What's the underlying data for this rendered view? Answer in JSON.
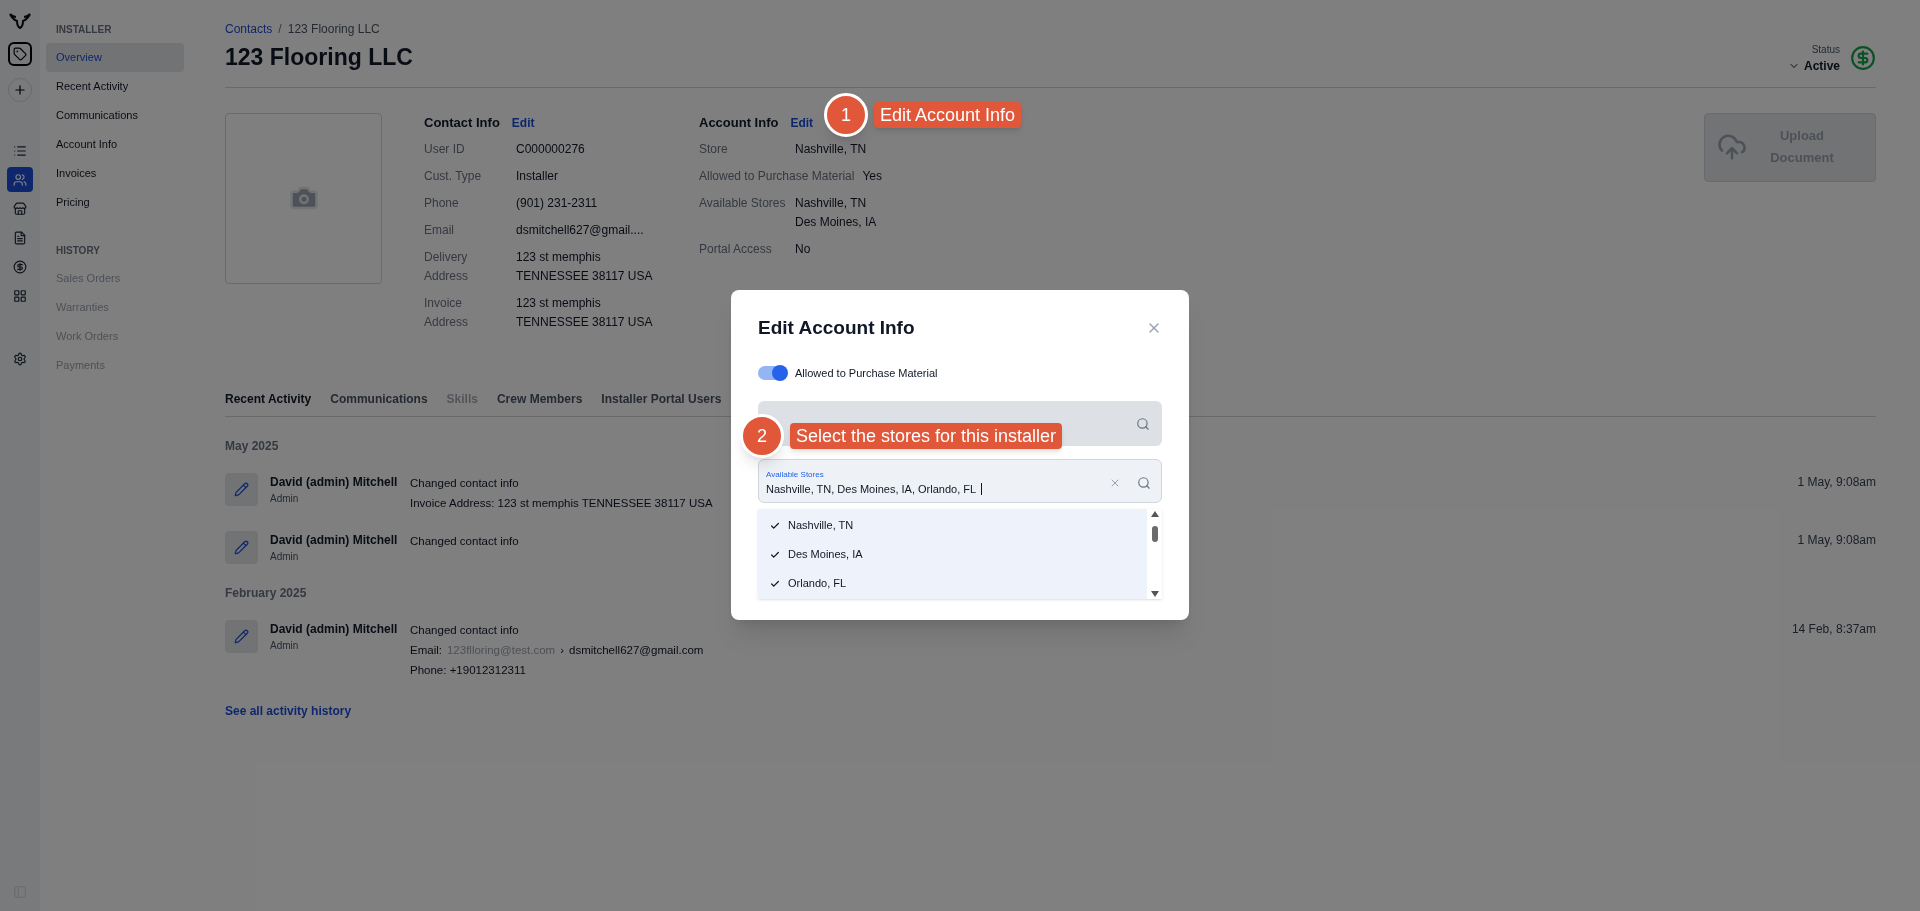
{
  "rail": [
    {
      "selected": false
    },
    {
      "selected": true
    },
    {
      "selected": false
    },
    {
      "selected": false
    },
    {
      "selected": false
    },
    {
      "selected": false
    },
    {
      "selected": false
    }
  ],
  "sidebar": [
    {
      "heading": "INSTALLER",
      "items": [
        {
          "label": "Overview",
          "selected": true,
          "disabled": false
        },
        {
          "label": "Recent Activity",
          "selected": false,
          "disabled": false
        },
        {
          "label": "Communications",
          "selected": false,
          "disabled": false
        },
        {
          "label": "Account Info",
          "selected": false,
          "disabled": false
        },
        {
          "label": "Invoices",
          "selected": false,
          "disabled": false
        },
        {
          "label": "Pricing",
          "selected": false,
          "disabled": false
        }
      ]
    },
    {
      "heading": "HISTORY",
      "items": [
        {
          "label": "Sales Orders",
          "selected": false,
          "disabled": true
        },
        {
          "label": "Warranties",
          "selected": false,
          "disabled": true
        },
        {
          "label": "Work Orders",
          "selected": false,
          "disabled": true
        },
        {
          "label": "Payments",
          "selected": false,
          "disabled": true
        }
      ]
    }
  ],
  "breadcrumb": {
    "link": "Contacts",
    "separator": "/",
    "current": "123 Flooring LLC"
  },
  "title": "123 Flooring LLC",
  "status": {
    "label": "Status",
    "value": "Active"
  },
  "contact_info": {
    "title": "Contact Info",
    "edit": "Edit",
    "rows": [
      {
        "label": "User ID",
        "values": [
          "C000000276"
        ]
      },
      {
        "label": "Cust. Type",
        "values": [
          "Installer"
        ]
      },
      {
        "label": "Phone",
        "values": [
          "(901) 231-2311"
        ]
      },
      {
        "label": "Email",
        "values": [
          "dsmitchell627@gmail...."
        ]
      },
      {
        "label": "Delivery Address",
        "values": [
          "123 st memphis",
          "TENNESSEE 38117 USA"
        ]
      },
      {
        "label": "Invoice Address",
        "values": [
          "123 st memphis",
          "TENNESSEE 38117 USA"
        ]
      }
    ]
  },
  "account_info": {
    "title": "Account Info",
    "edit": "Edit",
    "rows": [
      {
        "label": "Store",
        "values": [
          "Nashville, TN"
        ]
      },
      {
        "label": "Allowed to Purchase Material",
        "values": [
          "Yes"
        ]
      },
      {
        "label": "Available Stores",
        "values": [
          "Nashville, TN",
          "Des Moines, IA"
        ]
      },
      {
        "label": "Portal Access",
        "values": [
          "No"
        ]
      }
    ]
  },
  "upload": {
    "label": "Upload Document",
    "disabled": true
  },
  "tabs": [
    {
      "label": "Recent Activity",
      "selected": true,
      "disabled": false
    },
    {
      "label": "Communications",
      "selected": false,
      "disabled": false
    },
    {
      "label": "Skills",
      "selected": false,
      "disabled": true
    },
    {
      "label": "Crew Members",
      "selected": false,
      "disabled": false
    },
    {
      "label": "Installer Portal Users",
      "selected": false,
      "disabled": false
    }
  ],
  "activity": [
    {
      "month": "May 2025",
      "entries": [
        {
          "name": "David (admin) Mitchell",
          "role": "Admin",
          "time": "1 May, 9:08am",
          "lines": [
            {
              "kind": "text",
              "text": "Changed contact info"
            },
            {
              "kind": "text",
              "text": "Invoice Address: 123 st memphis TENNESSEE 38117 USA"
            }
          ]
        },
        {
          "name": "David (admin) Mitchell",
          "role": "Admin",
          "time": "1 May, 9:08am",
          "lines": [
            {
              "kind": "text",
              "text": "Changed contact info"
            }
          ]
        }
      ]
    },
    {
      "month": "February 2025",
      "entries": [
        {
          "name": "David (admin) Mitchell",
          "role": "Admin",
          "time": "14 Feb, 8:37am",
          "lines": [
            {
              "kind": "text",
              "text": "Changed contact info"
            },
            {
              "kind": "change",
              "label": "Email:",
              "old": "123flloring@test.com",
              "arrow": "›",
              "new": "dsmitchell627@gmail.com"
            },
            {
              "kind": "text",
              "text": "Phone: +19012312311"
            }
          ]
        }
      ]
    }
  ],
  "see_all": "See all activity history",
  "modal": {
    "title": "Edit Account Info",
    "toggle": {
      "label": "Allowed to Purchase Material",
      "on": true
    },
    "store_field": {
      "disabled": true
    },
    "available_stores": {
      "label": "Available Stores",
      "value": "Nashville, TN, Des Moines, IA, Orlando, FL",
      "options": [
        {
          "label": "Nashville, TN",
          "checked": true
        },
        {
          "label": "Des Moines, IA",
          "checked": true
        },
        {
          "label": "Orlando, FL",
          "checked": true
        }
      ]
    }
  },
  "annotations": [
    {
      "number": "1",
      "text": "Edit Account Info"
    },
    {
      "number": "2",
      "text": "Select the stores for this installer"
    }
  ]
}
